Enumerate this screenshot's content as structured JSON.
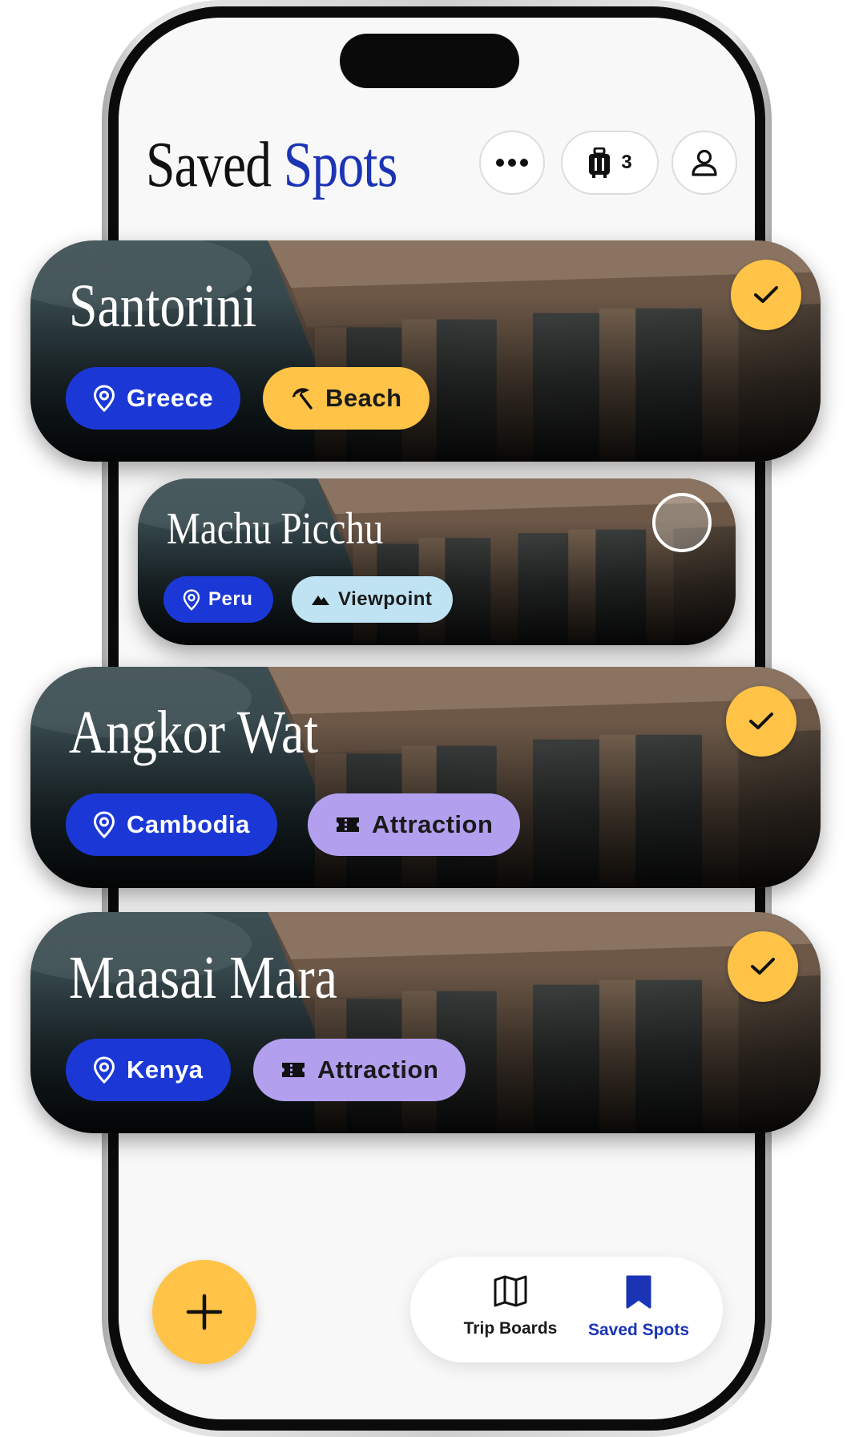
{
  "header": {
    "title_part1": "Saved",
    "title_part2": "Spots",
    "trip_count": "3"
  },
  "icons": {
    "more": "more-horizontal-icon",
    "luggage": "luggage-icon",
    "profile": "user-icon",
    "location": "map-pin-icon",
    "beach": "beach-umbrella-icon",
    "viewpoint": "mountain-icon",
    "attraction": "ticket-icon",
    "check": "check-icon",
    "add": "plus-icon",
    "trip_boards": "map-icon",
    "saved_spots": "bookmark-icon"
  },
  "spots": [
    {
      "name": "Santorini",
      "country": "Greece",
      "category": "Beach",
      "selected": true
    },
    {
      "name": "Machu Picchu",
      "country": "Peru",
      "category": "Viewpoint",
      "selected": false
    },
    {
      "name": "Angkor Wat",
      "country": "Cambodia",
      "category": "Attraction",
      "selected": true
    },
    {
      "name": "Maasai Mara",
      "country": "Kenya",
      "category": "Attraction",
      "selected": true
    }
  ],
  "bottom_nav": {
    "items": [
      {
        "label": "Trip Boards",
        "active": false
      },
      {
        "label": "Saved Spots",
        "active": true
      }
    ]
  },
  "colors": {
    "accent_blue": "#1b34b5",
    "location_chip": "#1b38d6",
    "yellow": "#ffc447",
    "viewpoint_chip": "#c0e3f3",
    "attraction_chip": "#b2a0ef"
  }
}
